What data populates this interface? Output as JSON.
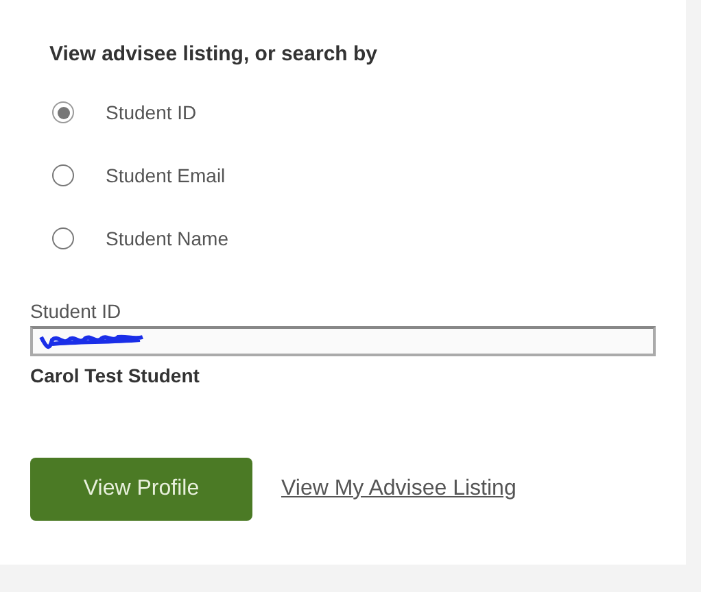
{
  "heading": "View advisee listing, or search by",
  "search_options": [
    {
      "label": "Student ID",
      "selected": true
    },
    {
      "label": "Student Email",
      "selected": false
    },
    {
      "label": "Student Name",
      "selected": false
    }
  ],
  "field": {
    "label": "Student ID",
    "redacted": true
  },
  "result_name": "Carol Test Student",
  "primary_button": "View Profile",
  "link": "View My Advisee Listing"
}
